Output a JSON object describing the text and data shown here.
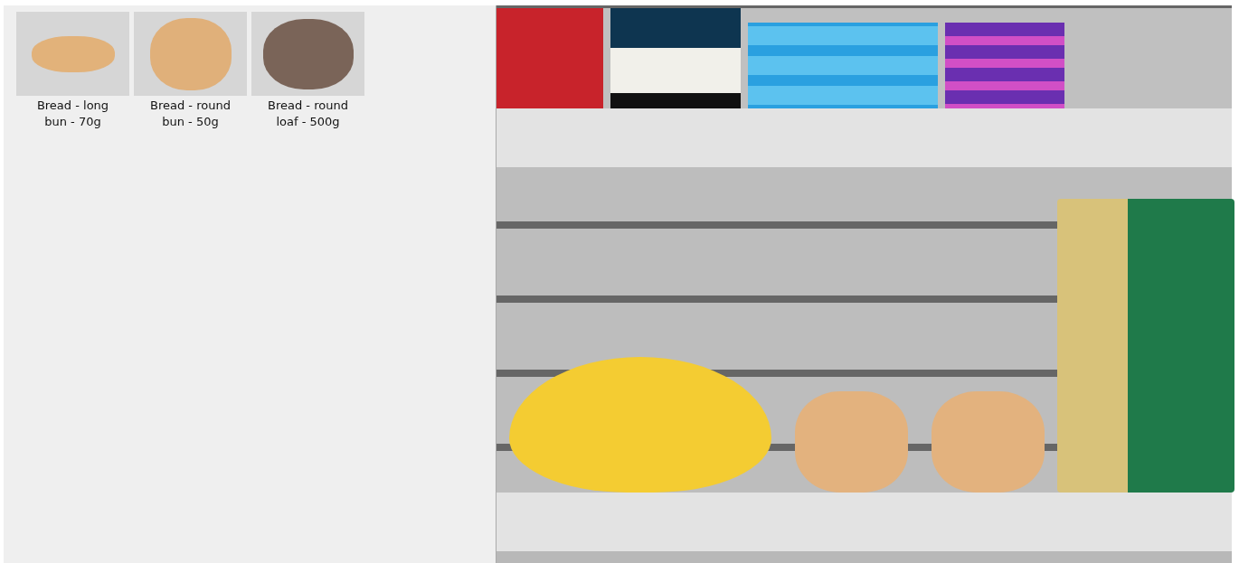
{
  "products": [
    {
      "label": "Bread - long bun - 70g",
      "kind": "long"
    },
    {
      "label": "Bread - round bun - 50g",
      "kind": "round"
    },
    {
      "label": "Bread - round loaf - 500g",
      "kind": "loaf"
    }
  ]
}
